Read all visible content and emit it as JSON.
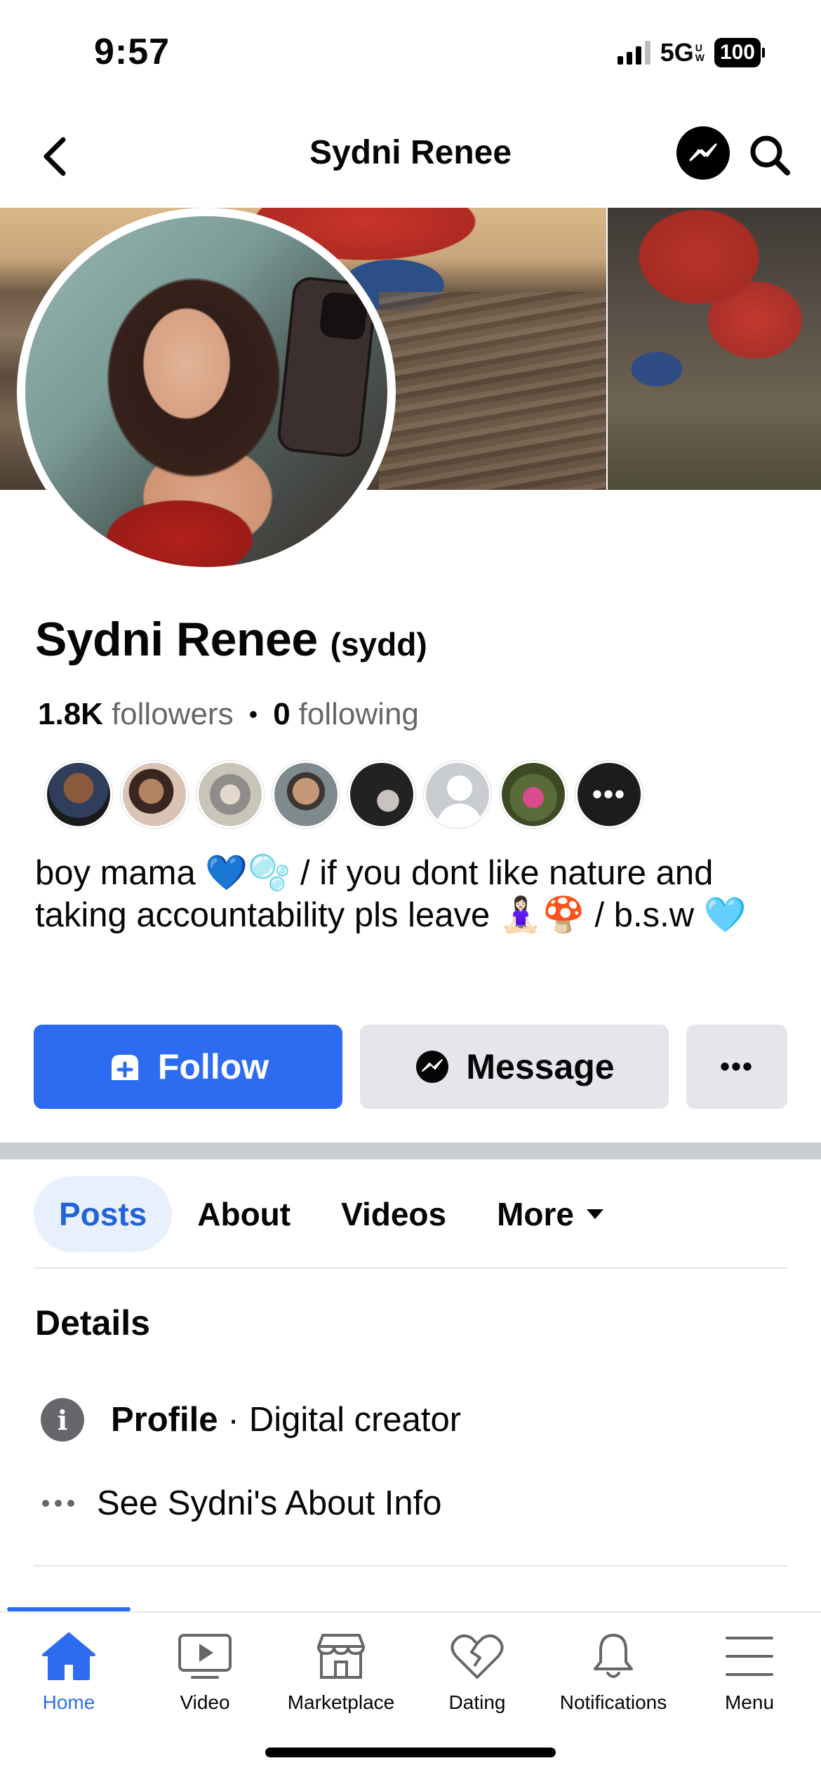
{
  "status_bar": {
    "time": "9:57",
    "network": "5G",
    "network_badge_top": "UW",
    "battery": "100"
  },
  "header": {
    "title": "Sydni Renee",
    "back_icon": "chevron-left-icon",
    "messenger_icon": "messenger-icon",
    "search_icon": "search-icon"
  },
  "profile": {
    "name": "Sydni Renee",
    "nickname": "(sydd)",
    "followers_count": "1.8K",
    "followers_label": "followers",
    "following_count": "0",
    "following_label": "following",
    "more_friends_label": "•••",
    "bio_text": "boy mama 💙🫧 / if you dont like nature and taking accountability pls leave 🧘🏻‍♀️🍄 / b.s.w 🩵"
  },
  "actions": {
    "follow_label": "Follow",
    "message_label": "Message",
    "more_label": "•••"
  },
  "tabs": [
    {
      "label": "Posts",
      "active": true
    },
    {
      "label": "About",
      "active": false
    },
    {
      "label": "Videos",
      "active": false
    },
    {
      "label": "More",
      "active": false
    }
  ],
  "details": {
    "title": "Details",
    "profile_label": "Profile",
    "profile_separator": "·",
    "profile_value": "Digital creator",
    "about_link": "See Sydni's About Info"
  },
  "bottom_nav": [
    {
      "label": "Home",
      "icon": "home-icon",
      "active": true
    },
    {
      "label": "Video",
      "icon": "video-icon",
      "active": false
    },
    {
      "label": "Marketplace",
      "icon": "marketplace-icon",
      "active": false
    },
    {
      "label": "Dating",
      "icon": "dating-icon",
      "active": false
    },
    {
      "label": "Notifications",
      "icon": "bell-icon",
      "active": false
    },
    {
      "label": "Menu",
      "icon": "menu-icon",
      "active": false
    }
  ],
  "colors": {
    "accent": "#2d6cf0",
    "secondary_button": "#e4e6eb",
    "muted_text": "#65676b",
    "active_tab_bg": "#e7f0fc"
  }
}
